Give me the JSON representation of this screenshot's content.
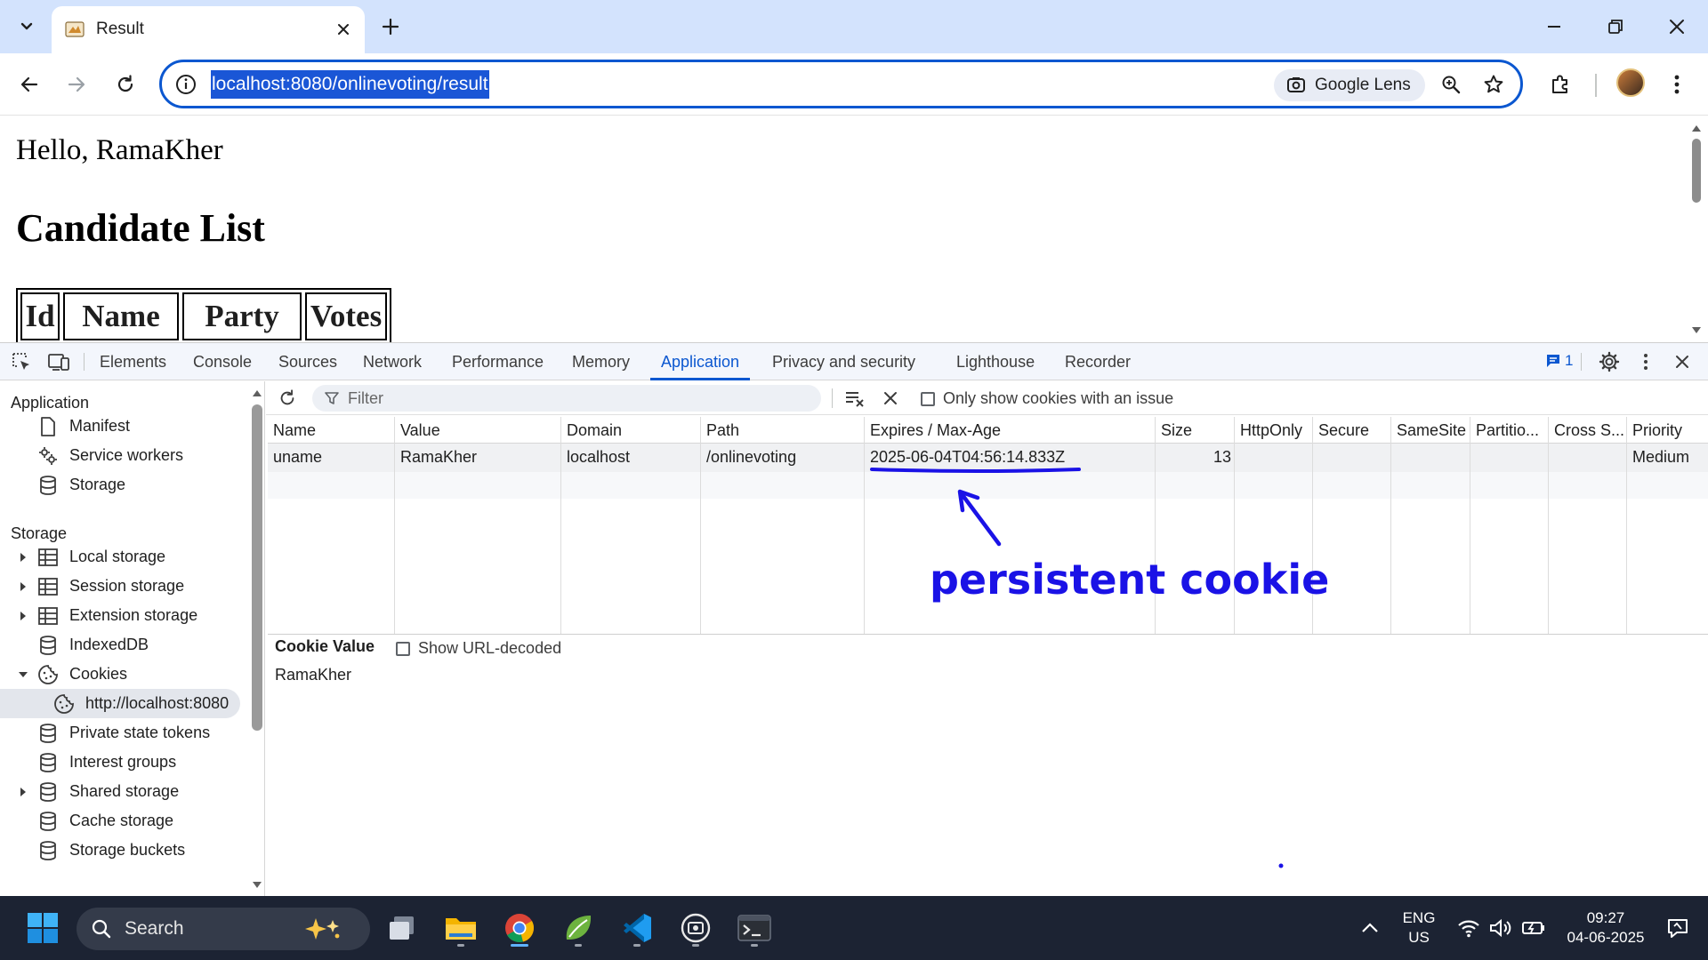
{
  "browser": {
    "tab_title": "Result",
    "url": "localhost:8080/onlinevoting/result",
    "lens_label": "Google Lens"
  },
  "page": {
    "greeting": "Hello, RamaKher",
    "heading": "Candidate List",
    "table_headers": [
      "Id",
      "Name",
      "Party",
      "Votes"
    ]
  },
  "devtools": {
    "tabs": [
      "Elements",
      "Console",
      "Sources",
      "Network",
      "Performance",
      "Memory",
      "Application",
      "Privacy and security",
      "Lighthouse",
      "Recorder"
    ],
    "active_tab": "Application",
    "issues_count": "1",
    "sidebar": {
      "application_section": "Application",
      "application_items": [
        "Manifest",
        "Service workers",
        "Storage"
      ],
      "storage_section": "Storage",
      "storage_items": [
        "Local storage",
        "Session storage",
        "Extension storage",
        "IndexedDB",
        "Cookies",
        "http://localhost:8080",
        "Private state tokens",
        "Interest groups",
        "Shared storage",
        "Cache storage",
        "Storage buckets"
      ]
    },
    "filter_placeholder": "Filter",
    "only_issue_label": "Only show cookies with an issue",
    "cookie_columns": [
      "Name",
      "Value",
      "Domain",
      "Path",
      "Expires / Max-Age",
      "Size",
      "HttpOnly",
      "Secure",
      "SameSite",
      "Partitio...",
      "Cross S...",
      "Priority"
    ],
    "cookie_rows": [
      {
        "name": "uname",
        "value": "RamaKher",
        "domain": "localhost",
        "path": "/onlinevoting",
        "expires": "2025-06-04T04:56:14.833Z",
        "size": "13",
        "httponly": "",
        "secure": "",
        "samesite": "",
        "partition": "",
        "cross_site": "",
        "priority": "Medium"
      }
    ],
    "annotation": "persistent cookie",
    "cookie_value_label": "Cookie Value",
    "show_url_decoded_label": "Show URL-decoded",
    "cookie_value": "RamaKher"
  },
  "taskbar": {
    "search_label": "Search",
    "language": "ENG",
    "region": "US",
    "time": "09:27",
    "date": "04-06-2025"
  },
  "colors": {
    "accent": "#0b57d0",
    "annotation": "#1a12e6",
    "tabstrip": "#d3e3fd",
    "taskbar": "#1c2333"
  }
}
